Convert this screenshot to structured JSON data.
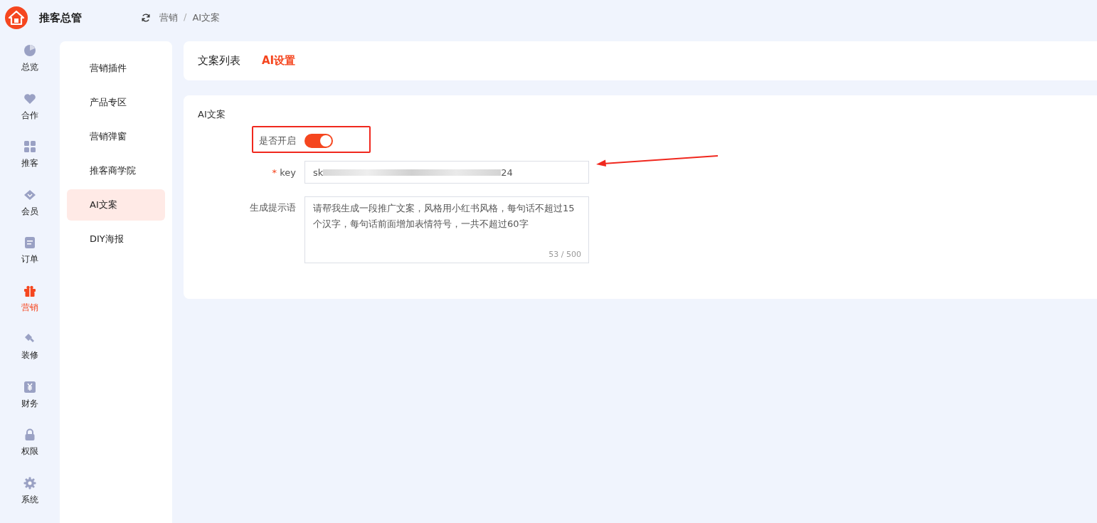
{
  "header": {
    "app_name": "推客总管",
    "breadcrumb": [
      "营销",
      "AI文案"
    ],
    "separator": "/"
  },
  "rail": [
    {
      "label": "总览",
      "kind": "pie",
      "selected": false
    },
    {
      "label": "合作",
      "kind": "heart",
      "selected": false
    },
    {
      "label": "推客",
      "kind": "grid",
      "selected": false
    },
    {
      "label": "会员",
      "kind": "gem",
      "selected": false
    },
    {
      "label": "订单",
      "kind": "doc",
      "selected": false
    },
    {
      "label": "营销",
      "kind": "gift",
      "selected": true
    },
    {
      "label": "装修",
      "kind": "brush",
      "selected": false
    },
    {
      "label": "财务",
      "kind": "yen",
      "selected": false
    },
    {
      "label": "权限",
      "kind": "lock",
      "selected": false
    },
    {
      "label": "系统",
      "kind": "gear",
      "selected": false
    }
  ],
  "submenu": [
    {
      "label": "营销插件",
      "selected": false
    },
    {
      "label": "产品专区",
      "selected": false
    },
    {
      "label": "营销弹窗",
      "selected": false
    },
    {
      "label": "推客商学院",
      "selected": false
    },
    {
      "label": "AI文案",
      "selected": true
    },
    {
      "label": "DIY海报",
      "selected": false
    }
  ],
  "tabs": [
    {
      "label": "文案列表",
      "selected": false
    },
    {
      "label": "AI设置",
      "selected": true
    }
  ],
  "form": {
    "title": "AI文案",
    "enabled": {
      "label": "是否开启",
      "on": true
    },
    "key": {
      "label": "key",
      "required_mark": "*",
      "value_start": "sk",
      "value_end": "24",
      "masked": true
    },
    "prompt": {
      "label": "生成提示语",
      "value": "请帮我生成一段推广文案，风格用小红书风格，每句话不超过15个汉字，每句话前面增加表情符号，一共不超过60字",
      "counter": "53 / 500"
    }
  },
  "annotations": {
    "highlight_box": true,
    "arrow": true
  }
}
